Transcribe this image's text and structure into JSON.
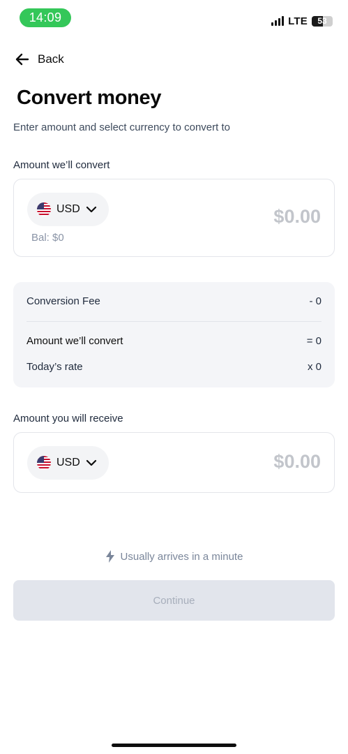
{
  "status_bar": {
    "time": "14:09",
    "network": "LTE",
    "battery": "53",
    "battery_level": 0.53,
    "time_pill_color": "#34c759"
  },
  "nav": {
    "back_label": "Back",
    "back_icon": "arrow-left-icon"
  },
  "header": {
    "title": "Convert money",
    "subtitle": "Enter amount and select currency to convert to"
  },
  "from": {
    "label": "Amount we’ll convert",
    "currency": "USD",
    "flag_icon": "us-flag-icon",
    "amount_placeholder": "$0.00",
    "balance": "Bal: $0"
  },
  "summary": {
    "fee_label": "Conversion Fee",
    "fee_value": "- 0",
    "convert_label": "Amount we’ll convert",
    "convert_value": "= 0",
    "rate_label": "Today’s rate",
    "rate_value": "x 0"
  },
  "to": {
    "label": "Amount you will receive",
    "currency": "USD",
    "flag_icon": "us-flag-icon",
    "amount_placeholder": "$0.00"
  },
  "footer": {
    "arrival_icon": "lightning-icon",
    "arrival_text": "Usually arrives in a minute",
    "continue_label": "Continue"
  },
  "colors": {
    "accent_disabled": "#e2e5ec",
    "summary_bg": "#f4f5f8",
    "muted_text": "#7a869a"
  }
}
